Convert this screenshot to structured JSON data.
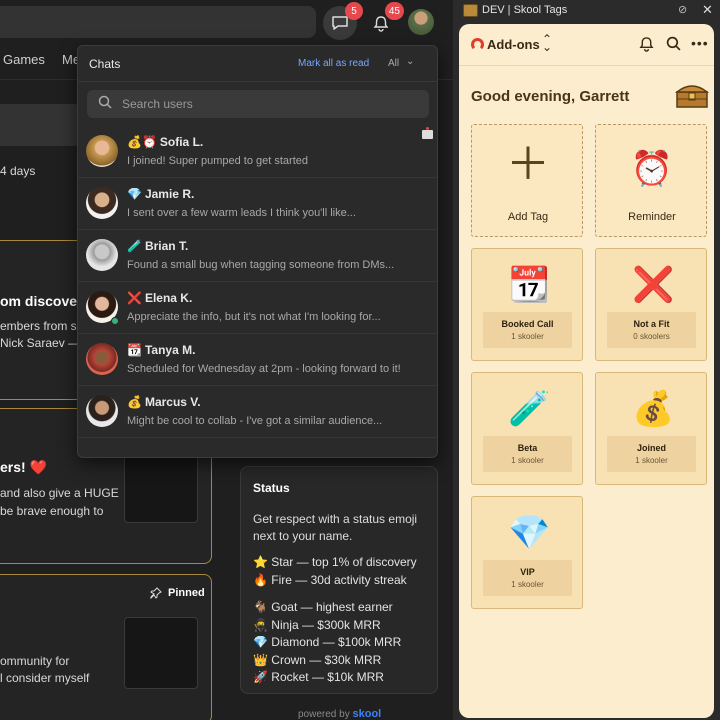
{
  "background_app": {
    "nav": {
      "games": "Games",
      "partial": "Me"
    },
    "badges": {
      "chat": "5",
      "notifications": "45"
    },
    "feed": {
      "snippet_days": "4 days",
      "post1_title": "om discovery",
      "post1_line1": "embers from sk",
      "post1_line2": "Nick Saraev —",
      "post2_title": "ers! ❤️",
      "post2_line1": "and also give a HUGE",
      "post2_line2": "be brave enough to",
      "post3_line1": "ommunity for",
      "post3_line2": "l consider myself",
      "pinned_label": "Pinned"
    },
    "status_card": {
      "title": "Status",
      "description": "Get respect with a status emoji next to your name.",
      "lines_a": [
        "⭐ Star — top 1% of discovery",
        "🔥 Fire — 30d activity streak"
      ],
      "lines_b": [
        "🐐 Goat — highest earner",
        "🥷 Ninja — $300k MRR",
        "💎 Diamond — $100k MRR",
        "👑 Crown — $30k MRR",
        "🚀 Rocket — $10k MRR"
      ]
    },
    "powered_by": "powered by",
    "powered_brand": "skool"
  },
  "chats_panel": {
    "title": "Chats",
    "mark_all_read": "Mark all as read",
    "filter": "All",
    "search_placeholder": "Search users",
    "items": [
      {
        "emoji": "💰⏰",
        "name": "Sofia L.",
        "preview": "I joined! Super pumped to get started"
      },
      {
        "emoji": "💎",
        "name": "Jamie R.",
        "preview": "I sent over a few warm leads I think you'll like..."
      },
      {
        "emoji": "🧪",
        "name": "Brian T.",
        "preview": "Found a small bug when tagging someone from DMs..."
      },
      {
        "emoji": "❌",
        "name": "Elena K.",
        "preview": "Appreciate the info, but it's not what I'm looking for..."
      },
      {
        "emoji": "📆",
        "name": "Tanya M.",
        "preview": "Scheduled for Wednesday at 2pm - looking forward to it!"
      },
      {
        "emoji": "💰",
        "name": "Marcus V.",
        "preview": "Might be cool to collab - I've got a similar audience..."
      }
    ]
  },
  "extension": {
    "window_title": "DEV | Skool Tags",
    "header_label": "Add-ons",
    "greeting": "Good evening, Garrett",
    "actions": [
      {
        "icon": "＋",
        "label": "Add Tag"
      },
      {
        "icon": "⏰",
        "label": "Reminder"
      }
    ],
    "tags": [
      {
        "icon": "📆",
        "name": "Booked Call",
        "count": "1 skooler"
      },
      {
        "icon": "❌",
        "name": "Not a Fit",
        "count": "0 skoolers"
      },
      {
        "icon": "🧪",
        "name": "Beta",
        "count": "1 skooler"
      },
      {
        "icon": "💰",
        "name": "Joined",
        "count": "1 skooler"
      },
      {
        "icon": "💎",
        "name": "VIP",
        "count": "1 skooler"
      }
    ],
    "colors": {
      "panel_bg": "#fbedcd",
      "tile_bg": "#f8e1b2",
      "accent": "#e03c2a"
    }
  }
}
